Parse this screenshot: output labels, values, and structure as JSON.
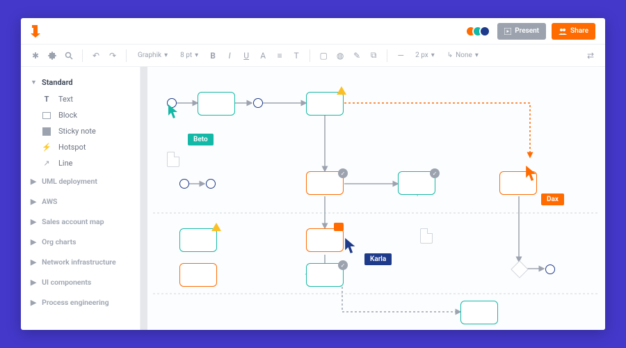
{
  "topbar": {
    "present_label": "Present",
    "share_label": "Share",
    "presence_colors": [
      "#ff6b00",
      "#14b8a6",
      "#1e3a8a"
    ]
  },
  "toolbar": {
    "font_select": "Graphik",
    "size_select": "8 pt",
    "stroke": "2 px",
    "arrow": "None"
  },
  "sidebar": {
    "standard_label": "Standard",
    "items": [
      {
        "label": "Text",
        "icon": "T"
      },
      {
        "label": "Block",
        "icon": "block"
      },
      {
        "label": "Sticky note",
        "icon": "note"
      },
      {
        "label": "Hotspot",
        "icon": "bolt"
      },
      {
        "label": "Line",
        "icon": "line"
      }
    ],
    "cats": [
      {
        "label": "UML deployment"
      },
      {
        "label": "AWS"
      },
      {
        "label": "Sales account map"
      },
      {
        "label": "Org charts"
      },
      {
        "label": "Network infrastructure"
      },
      {
        "label": "UI components"
      },
      {
        "label": "Process engineering"
      }
    ]
  },
  "cursors": {
    "beto": "Beto",
    "karla": "Karla",
    "dax": "Dax"
  }
}
